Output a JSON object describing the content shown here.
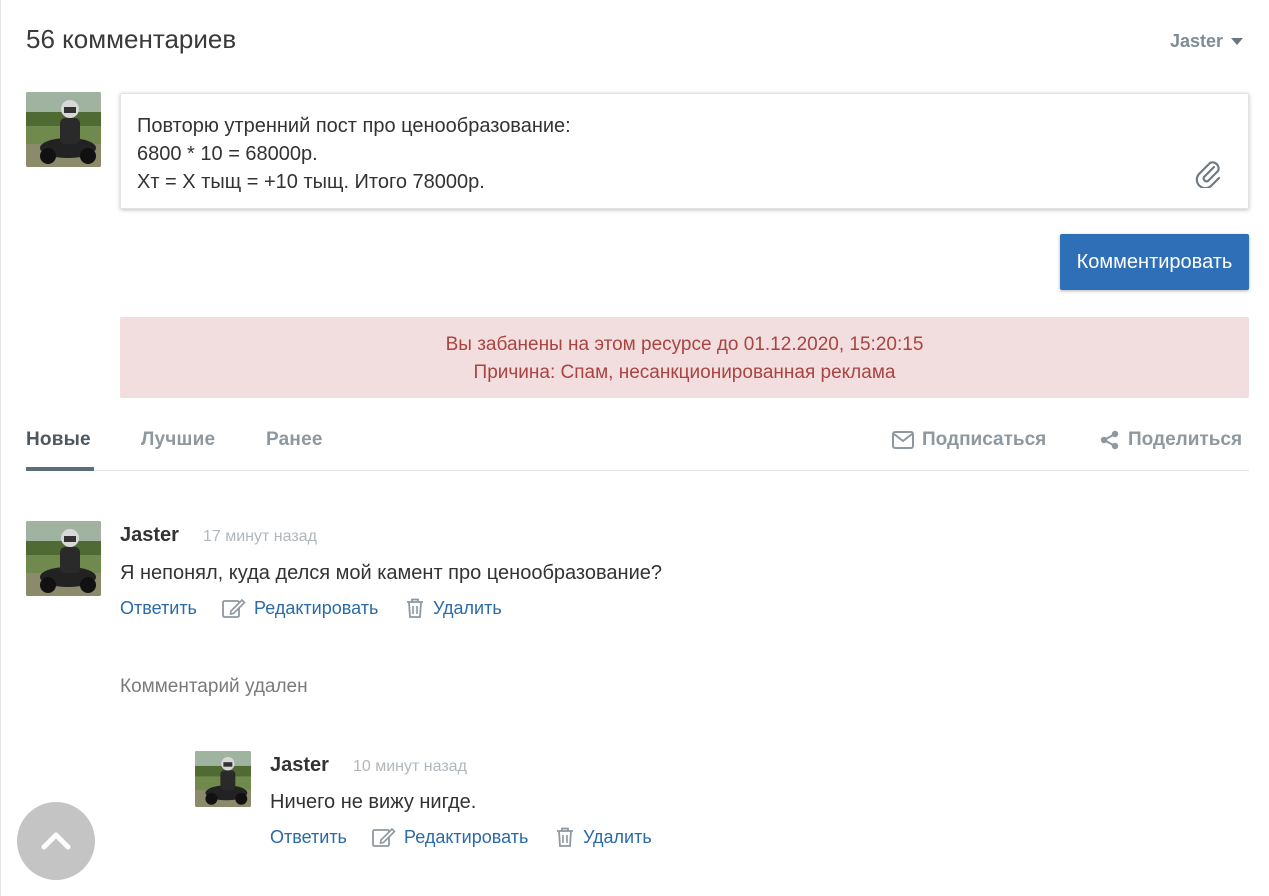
{
  "header": {
    "comment_count": "56 комментариев",
    "user_name": "Jaster"
  },
  "composer": {
    "text": "Повторю утренний пост про ценообразование:\n6800 * 10 = 68000р.\nХт = Х тыщ = +10 тыщ. Итого 78000р.",
    "submit_label": "Комментировать"
  },
  "ban": {
    "line1": "Вы забанены на этом ресурсе до 01.12.2020, 15:20:15",
    "line2": "Причина: Спам, несанкционированная реклама"
  },
  "tabs": {
    "new": "Новые",
    "best": "Лучшие",
    "earlier": "Ранее",
    "subscribe": "Подписаться",
    "share": "Поделиться"
  },
  "comments": [
    {
      "author": "Jaster",
      "time": "17 минут назад",
      "text": "Я непонял, куда делся мой камент про ценообразование?",
      "reply": "Ответить",
      "edit": "Редактировать",
      "delete": "Удалить"
    },
    {
      "author": "Jaster",
      "time": "10 минут назад",
      "text": "Ничего не вижу нигде.",
      "reply": "Ответить",
      "edit": "Редактировать",
      "delete": "Удалить"
    }
  ],
  "deleted_note": "Комментарий удален",
  "colors": {
    "primary": "#2e6fb7",
    "alert_bg": "#f2dede",
    "alert_text": "#a94442",
    "link": "#2a6aa8"
  }
}
